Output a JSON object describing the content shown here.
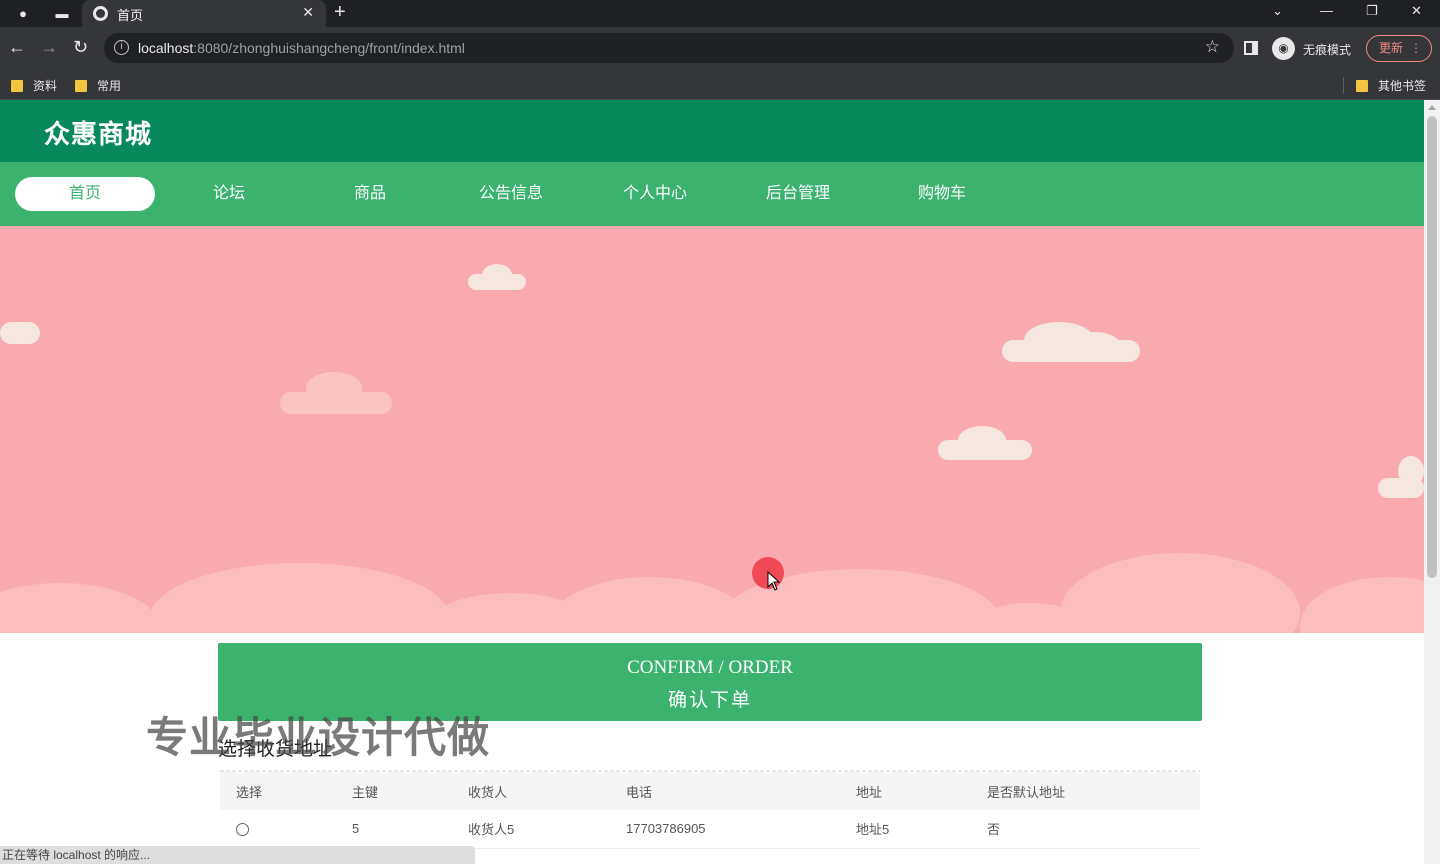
{
  "browser": {
    "tab_title": "首页",
    "url_host": "localhost",
    "url_rest": ":8080/zhonghuishangcheng/front/index.html",
    "incognito_label": "无痕模式",
    "update_label": "更新",
    "bookmarks": [
      "资料",
      "常用"
    ],
    "other_bookmarks": "其他书签",
    "status_text": "正在等待 localhost 的响应..."
  },
  "site": {
    "logo": "众惠商城",
    "nav": [
      "首页",
      "论坛",
      "商品",
      "公告信息",
      "个人中心",
      "后台管理",
      "购物车"
    ],
    "active_nav": "首页"
  },
  "confirm": {
    "title_en": "CONFIRM / ORDER",
    "title_cn": "确认下单"
  },
  "address_section": {
    "label": "选择收货地址",
    "watermark": "专业毕业设计代做",
    "columns": [
      "选择",
      "主键",
      "收货人",
      "电话",
      "地址",
      "是否默认地址"
    ],
    "rows": [
      {
        "id": "5",
        "name": "收货人5",
        "phone": "17703786905",
        "address": "地址5",
        "default": "否"
      }
    ]
  },
  "colors": {
    "header": "#08895c",
    "nav": "#3bb36f",
    "banner": "#f9aab1"
  }
}
